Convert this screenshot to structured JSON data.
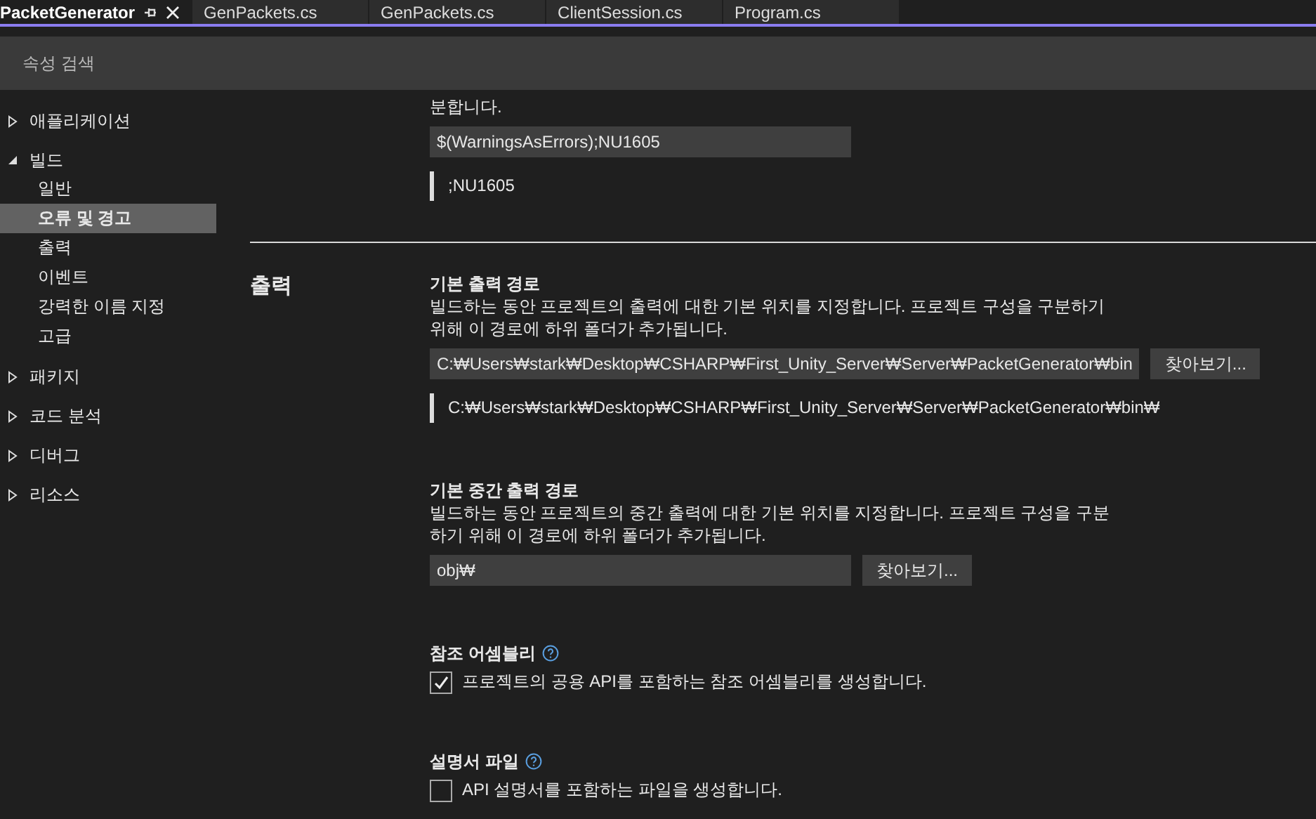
{
  "tabs": [
    {
      "label": "PacketGenerator",
      "selected": true
    },
    {
      "label": "GenPackets.cs",
      "selected": false
    },
    {
      "label": "GenPackets.cs",
      "selected": false
    },
    {
      "label": "ClientSession.cs",
      "selected": false
    },
    {
      "label": "Program.cs",
      "selected": false
    }
  ],
  "search": {
    "placeholder": "속성 검색"
  },
  "sidebar": {
    "items": [
      {
        "label": "애플리케이션",
        "expanded": false
      },
      {
        "label": "빌드",
        "expanded": true,
        "children": [
          {
            "label": "일반",
            "selected": false
          },
          {
            "label": "오류 및 경고",
            "selected": true
          },
          {
            "label": "출력",
            "selected": false
          },
          {
            "label": "이벤트",
            "selected": false
          },
          {
            "label": "강력한 이름 지정",
            "selected": false
          },
          {
            "label": "고급",
            "selected": false
          }
        ]
      },
      {
        "label": "패키지",
        "expanded": false
      },
      {
        "label": "코드 분석",
        "expanded": false
      },
      {
        "label": "디버그",
        "expanded": false
      },
      {
        "label": "리소스",
        "expanded": false
      }
    ]
  },
  "top_fragment": {
    "description": "분합니다.",
    "value": "$(WarningsAsErrors);NU1605",
    "preview": ";NU1605"
  },
  "section": {
    "title": "출력",
    "properties": [
      {
        "kind": "path",
        "title": "기본 출력 경로",
        "description": "빌드하는 동안 프로젝트의 출력에 대한 기본 위치를 지정합니다. 프로젝트 구성을 구분하기 위해 이 경로에 하위 폴더가 추가됩니다.",
        "value": "C:₩Users₩stark₩Desktop₩CSHARP₩First_Unity_Server₩Server₩PacketGenerator₩bin",
        "button": "찾아보기...",
        "preview": "C:₩Users₩stark₩Desktop₩CSHARP₩First_Unity_Server₩Server₩PacketGenerator₩bin₩"
      },
      {
        "kind": "path",
        "title": "기본 중간 출력 경로",
        "description": "빌드하는 동안 프로젝트의 중간 출력에 대한 기본 위치를 지정합니다. 프로젝트 구성을 구분하기 위해 이 경로에 하위 폴더가 추가됩니다.",
        "value": "obj₩",
        "button": "찾아보기..."
      },
      {
        "kind": "checkbox",
        "title": "참조 어셈블리",
        "label": "프로젝트의 공용 API를 포함하는 참조 어셈블리를 생성합니다.",
        "checked": true
      },
      {
        "kind": "checkbox",
        "title": "설명서 파일",
        "label": "API 설명서를 포함하는 파일을 생성합니다.",
        "checked": false
      }
    ]
  }
}
